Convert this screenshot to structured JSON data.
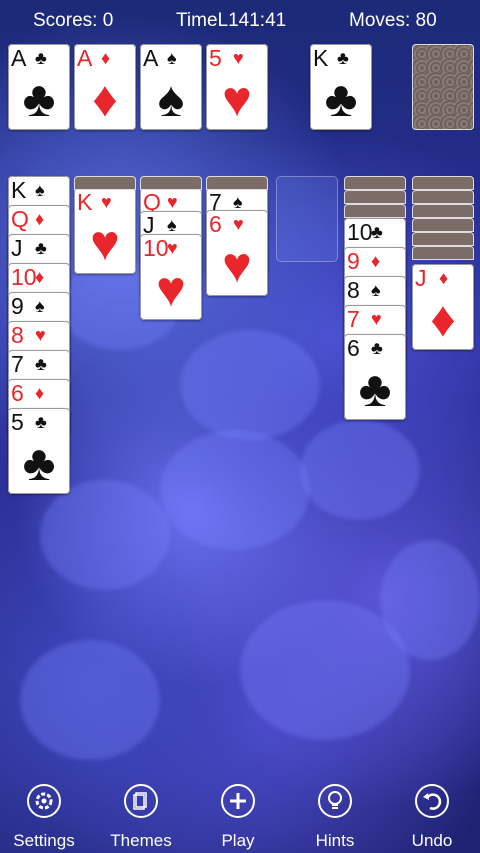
{
  "header": {
    "score": "Scores: 0",
    "time": "TimeL141:41",
    "moves": "Moves: 80"
  },
  "foundation": [
    {
      "rank": "A",
      "suit": "♣",
      "color": "black"
    },
    {
      "rank": "A",
      "suit": "♦",
      "color": "red"
    },
    {
      "rank": "A",
      "suit": "♠",
      "color": "black"
    },
    {
      "rank": "5",
      "suit": "♥",
      "color": "red"
    }
  ],
  "waste": {
    "rank": "K",
    "suit": "♣",
    "color": "black"
  },
  "tableau": {
    "col1": [
      {
        "rank": "K",
        "suit": "♠",
        "color": "black"
      },
      {
        "rank": "Q",
        "suit": "♦",
        "color": "red"
      },
      {
        "rank": "J",
        "suit": "♣",
        "color": "black"
      },
      {
        "rank": "10",
        "suit": "♦",
        "color": "red"
      },
      {
        "rank": "9",
        "suit": "♠",
        "color": "black"
      },
      {
        "rank": "8",
        "suit": "♥",
        "color": "red"
      },
      {
        "rank": "7",
        "suit": "♣",
        "color": "black"
      },
      {
        "rank": "6",
        "suit": "♦",
        "color": "red"
      },
      {
        "rank": "5",
        "suit": "♣",
        "color": "black"
      }
    ],
    "col2": [
      {
        "rank": "K",
        "suit": "♥",
        "color": "red"
      }
    ],
    "col3": [
      {
        "rank": "Q",
        "suit": "♥",
        "color": "red"
      },
      {
        "rank": "J",
        "suit": "♠",
        "color": "black"
      },
      {
        "rank": "10",
        "suit": "♥",
        "color": "red"
      }
    ],
    "col4": [
      {
        "rank": "7",
        "suit": "♠",
        "color": "black"
      },
      {
        "rank": "6",
        "suit": "♥",
        "color": "red"
      }
    ],
    "col6": [
      {
        "rank": "10",
        "suit": "♣",
        "color": "black"
      },
      {
        "rank": "9",
        "suit": "♦",
        "color": "red"
      },
      {
        "rank": "8",
        "suit": "♠",
        "color": "black"
      },
      {
        "rank": "7",
        "suit": "♥",
        "color": "red"
      },
      {
        "rank": "6",
        "suit": "♣",
        "color": "black"
      }
    ],
    "col7": [
      {
        "rank": "J",
        "suit": "♦",
        "color": "red"
      }
    ]
  },
  "toolbar": {
    "settings": "Settings",
    "themes": "Themes",
    "play": "Play",
    "hints": "Hints",
    "undo": "Undo"
  },
  "colors": {
    "red": "#e8262b",
    "black": "#111111"
  }
}
